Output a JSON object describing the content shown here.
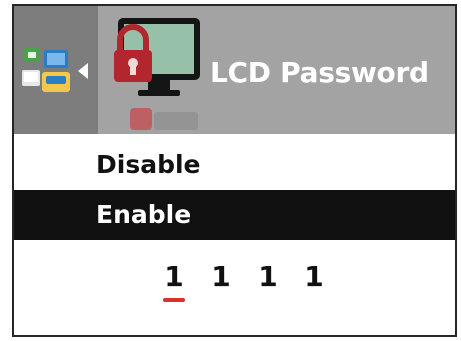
{
  "header": {
    "title": "LCD Password",
    "nav_icon": "multi-view-icon",
    "back_icon": "back-arrow-icon",
    "current_icon": "lcd-lock-icon",
    "next_icon": "next-item-icon"
  },
  "options": [
    {
      "label": "Disable",
      "selected": false
    },
    {
      "label": "Enable",
      "selected": true
    }
  ],
  "password": {
    "digits": [
      "1",
      "1",
      "1",
      "1"
    ],
    "cursor_index": 0
  },
  "colors": {
    "header_bg": "#a3a3a3",
    "nav_bg": "#7d7d7d",
    "selected_bg": "#111111",
    "cursor": "#d93030",
    "lock": "#b3262e"
  }
}
